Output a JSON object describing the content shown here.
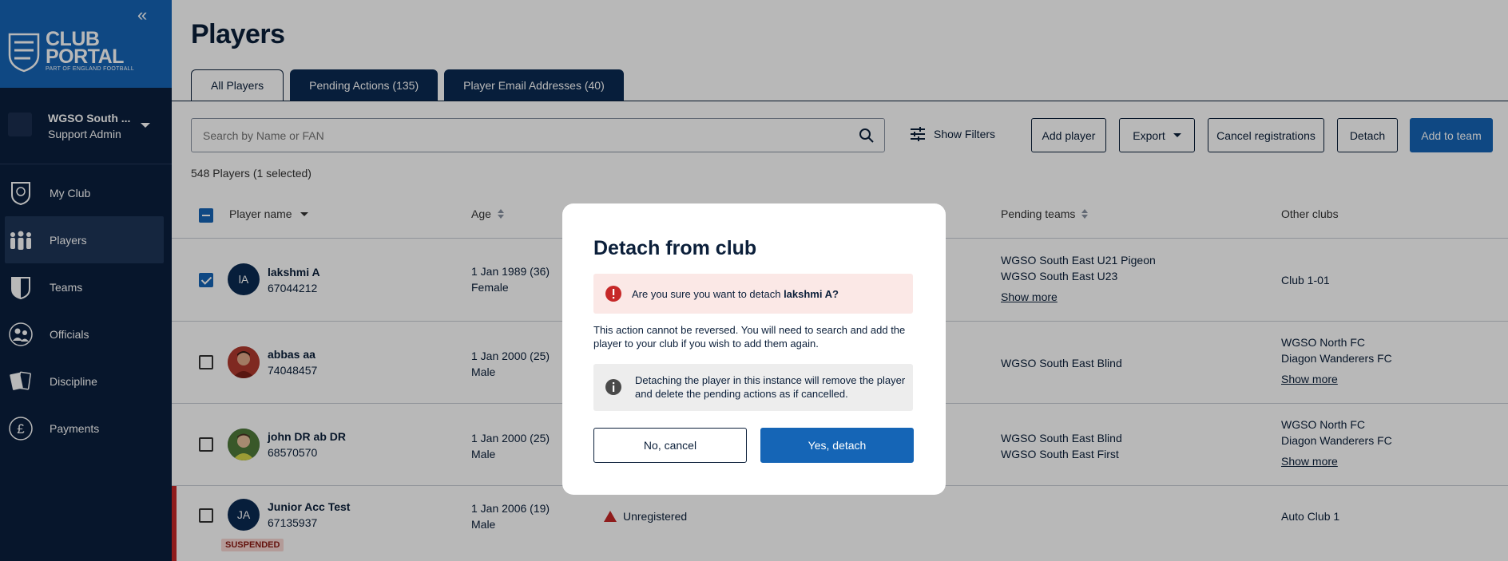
{
  "sidebar": {
    "logo_line1": "CLUB",
    "logo_line2": "PORTAL",
    "logo_sub": "PART OF ENGLAND FOOTBALL",
    "account": {
      "name": "WGSO South ...",
      "role": "Support Admin"
    },
    "items": [
      {
        "label": "My Club",
        "icon": "club-crest-icon"
      },
      {
        "label": "Players",
        "icon": "players-icon",
        "active": true
      },
      {
        "label": "Teams",
        "icon": "shield-icon"
      },
      {
        "label": "Officials",
        "icon": "officials-icon"
      },
      {
        "label": "Discipline",
        "icon": "cards-icon"
      },
      {
        "label": "Payments",
        "icon": "pound-icon"
      }
    ]
  },
  "page": {
    "title": "Players"
  },
  "tabs": [
    {
      "label": "All Players"
    },
    {
      "label": "Pending Actions (135)"
    },
    {
      "label": "Player Email Addresses (40)"
    }
  ],
  "toolbar": {
    "search_placeholder": "Search by Name or FAN",
    "show_filters": "Show Filters",
    "add_player": "Add player",
    "export": "Export",
    "cancel_registrations": "Cancel registrations",
    "detach": "Detach",
    "add_to_team": "Add to team"
  },
  "count_text": "548 Players (1 selected)",
  "table": {
    "headers": {
      "player_name": "Player name",
      "age": "Age",
      "pending_teams": "Pending teams",
      "other_clubs": "Other clubs"
    },
    "rows": [
      {
        "initials": "lA",
        "name": "lakshmi A",
        "fan": "67044212",
        "dob": "1 Jan 1989 (36)",
        "gender": "Female",
        "pending": [
          "WGSO South East U21 Pigeon",
          "WGSO South East U23"
        ],
        "pending_more": "Show more",
        "clubs": [
          "Club 1-01"
        ]
      },
      {
        "name": "abbas aa",
        "fan": "74048457",
        "dob": "1 Jan 2000 (25)",
        "gender": "Male",
        "pending": [
          "WGSO South East Blind"
        ],
        "clubs": [
          "WGSO North FC",
          "Diagon Wanderers FC"
        ],
        "clubs_more": "Show more"
      },
      {
        "name": "john DR ab DR",
        "fan": "68570570",
        "dob": "1 Jan 2000 (25)",
        "gender": "Male",
        "pending": [
          "WGSO South East Blind",
          "WGSO South East First"
        ],
        "clubs": [
          "WGSO North FC",
          "Diagon Wanderers FC"
        ],
        "clubs_more": "Show more"
      },
      {
        "initials": "JA",
        "name": "Junior Acc Test",
        "fan": "67135937",
        "dob": "1 Jan 2006 (19)",
        "gender": "Male",
        "status": "Unregistered",
        "badge": "SUSPENDED",
        "clubs": [
          "Auto Club 1"
        ]
      }
    ]
  },
  "modal": {
    "title": "Detach from club",
    "warning_prefix": "Are you sure you want to detach ",
    "warning_name": "lakshmi A?",
    "body": "This action cannot be reversed. You will need to search and add the player to your club if you wish to add them again.",
    "info": "Detaching the player in this instance will remove the player and delete the pending actions as if cancelled.",
    "cancel": "No, cancel",
    "confirm": "Yes, detach"
  },
  "colors": {
    "sidebar_bg": "#0a1f3d",
    "brand_blue": "#1565b6",
    "navy": "#0b1f3a",
    "suspended_red": "#c62828"
  }
}
